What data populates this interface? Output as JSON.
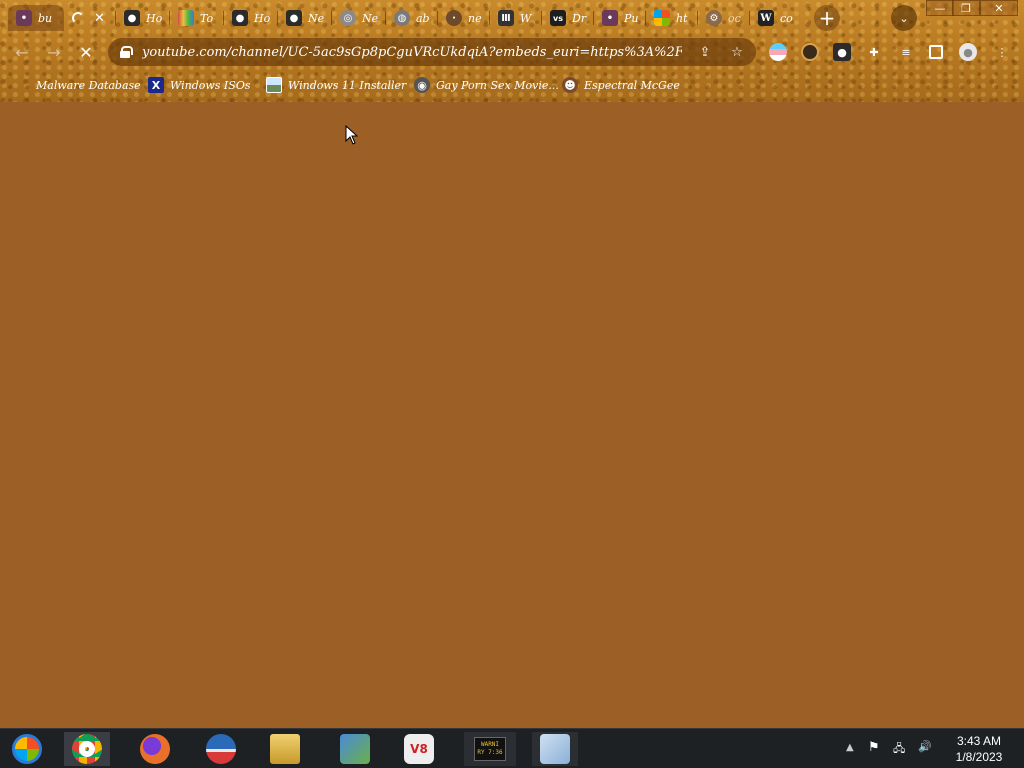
{
  "browser": {
    "tabs": [
      {
        "title": "bu",
        "active": true,
        "icon": "anime-face-icon",
        "color": "#6b3a5a"
      },
      {
        "title": "",
        "loading": true,
        "icon": "loading-spinner-icon",
        "color": "transparent"
      },
      {
        "title": "Ho",
        "icon": "tampermonkey-icon",
        "color": "#2b2b2b"
      },
      {
        "title": "To",
        "icon": "rainbow-icon",
        "color": "#d04a4a"
      },
      {
        "title": "Ho",
        "icon": "tampermonkey-icon",
        "color": "#2b2b2b"
      },
      {
        "title": "Ne",
        "icon": "tampermonkey-icon",
        "color": "#2b2b2b"
      },
      {
        "title": "Ne",
        "icon": "chrome-icon",
        "color": "#8a8a8a"
      },
      {
        "title": "ab",
        "icon": "globe-icon",
        "color": "#7a7a7a"
      },
      {
        "title": "ne",
        "icon": "cookie-icon",
        "color": "#6d4a2a"
      },
      {
        "title": "W",
        "icon": "museum-icon",
        "color": "#333333"
      },
      {
        "title": "Dr",
        "icon": "vs-icon",
        "color": "#1e1e1e"
      },
      {
        "title": "Pu",
        "icon": "anime-face-icon",
        "color": "#6b3a5a"
      },
      {
        "title": "ht",
        "icon": "windows-logo-icon",
        "color": "#e9a23b"
      },
      {
        "title": "oc",
        "icon": "gear-icon",
        "color": "#8b6a4a"
      },
      {
        "title": "co",
        "icon": "wikipedia-icon",
        "color": "#222222"
      }
    ],
    "close_tab_glyph": "✕",
    "new_tab_glyph": "+",
    "tab_search_glyph": "⌄",
    "window": {
      "minimize": "—",
      "restore": "❐",
      "close": "✕"
    },
    "toolbar": {
      "back": "←",
      "forward": "→",
      "reload": "✕",
      "url": "youtube.com/channel/UC-5ac9sGp8pCguVRcUkdqiA?embeds_euri=https%3A%2F...",
      "share": "⇪",
      "star": "☆",
      "extensions_glyph": "⚙",
      "menu": "⋮"
    },
    "bookmarks": [
      {
        "label": "Malware Database",
        "icon": "folder-icon",
        "color": "#8a5a1a"
      },
      {
        "label": "Windows ISOs",
        "icon": "x-icon",
        "color": "#1b2a8a",
        "glyph": "X"
      },
      {
        "label": "Windows 11 Installer",
        "icon": "image-icon",
        "color": "#6a8a5a"
      },
      {
        "label": "Gay Porn Sex Movie...",
        "icon": "disc-icon",
        "color": "#555555"
      },
      {
        "label": "Espectral McGee",
        "icon": "character-icon",
        "color": "#7a4a2a"
      }
    ]
  },
  "page": {
    "background": "#9c5f26"
  },
  "taskbar": {
    "apps": [
      {
        "name": "start",
        "icon": "start-orb-icon",
        "color": "#2a7ad8"
      },
      {
        "name": "chrome",
        "icon": "chrome-icon",
        "color": "#dd4a3a",
        "active": true
      },
      {
        "name": "firefox",
        "icon": "firefox-icon",
        "color": "#e8702a"
      },
      {
        "name": "opera",
        "icon": "opera-icon",
        "color": "#2a6ab8"
      },
      {
        "name": "explorer",
        "icon": "folder-icon",
        "color": "#d8b04a"
      },
      {
        "name": "network",
        "icon": "network-icon",
        "color": "#6ab04a"
      },
      {
        "name": "v8",
        "icon": "v8-icon",
        "color": "#eeeeee"
      },
      {
        "name": "warning-app",
        "icon": "warning-thumbnail-icon",
        "color": "#333333",
        "label": "WARNI",
        "sublabel": "RY 7:36"
      },
      {
        "name": "installer",
        "icon": "installer-icon",
        "color": "#8ab0d8"
      }
    ],
    "tray": {
      "arrow": "▲",
      "flag": "⚑",
      "network": "🖧",
      "volume": "🔊"
    },
    "time": "3:43 AM",
    "date": "1/8/2023"
  }
}
